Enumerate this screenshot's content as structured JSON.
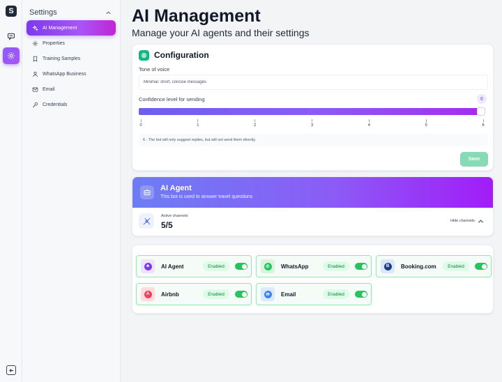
{
  "rail": {
    "logo": "S",
    "items": [
      {
        "icon": "chat-icon"
      },
      {
        "icon": "gear-icon",
        "active": true
      }
    ],
    "collapse_icon": "collapse-left-icon"
  },
  "sidebar": {
    "title": "Settings",
    "items": [
      {
        "label": "AI Management",
        "icon": "sparkles-icon",
        "active": true
      },
      {
        "label": "Properties",
        "icon": "gear-icon"
      },
      {
        "label": "Training Samples",
        "icon": "bookmark-icon"
      },
      {
        "label": "WhatsApp Business",
        "icon": "user-icon"
      },
      {
        "label": "Email",
        "icon": "mail-icon"
      },
      {
        "label": "Credentials",
        "icon": "key-icon"
      }
    ]
  },
  "header": {
    "title": "AI Management",
    "subtitle": "Manage your AI agents and their settings"
  },
  "config": {
    "title": "Configuration",
    "tone_label": "Tone of voice",
    "tone_value": "Minimal: short, concise messages",
    "confidence_label": "Confidence level for sending",
    "confidence_value": "6",
    "confidence_fraction": 1.0,
    "ticks": [
      "0",
      "1",
      "2",
      "3",
      "4",
      "5",
      "6"
    ],
    "hint": "6 - The bot will only suggest replies, but will not send them directly.",
    "save_label": "Save"
  },
  "agent": {
    "name": "AI Agent",
    "description": "This bot is used to answer travel questions",
    "active_channels_label": "Active channels",
    "active_channels_count": "5/5",
    "hide_channels_label": "Hide channels"
  },
  "channels": [
    {
      "name": "AI Agent",
      "status": "Enabled",
      "enabled": true,
      "icon": "robot-icon",
      "bg": "#ede4fb",
      "color": "#7c3aed",
      "glyph": "☻"
    },
    {
      "name": "WhatsApp",
      "status": "Enabled",
      "enabled": true,
      "icon": "whatsapp-icon",
      "bg": "#d9f3df",
      "color": "#22c55e",
      "glyph": "✆"
    },
    {
      "name": "Booking.com",
      "status": "Enabled",
      "enabled": true,
      "icon": "booking-icon",
      "bg": "#dbe7f8",
      "color": "#1e3a8a",
      "glyph": "B"
    },
    {
      "name": "Airbnb",
      "status": "Enabled",
      "enabled": true,
      "icon": "airbnb-icon",
      "bg": "#fbdcdc",
      "color": "#f43f5e",
      "glyph": "A"
    },
    {
      "name": "Email",
      "status": "Enabled",
      "enabled": true,
      "icon": "mail-icon",
      "bg": "#dbeaf8",
      "color": "#3b82f6",
      "glyph": "✉"
    }
  ]
}
